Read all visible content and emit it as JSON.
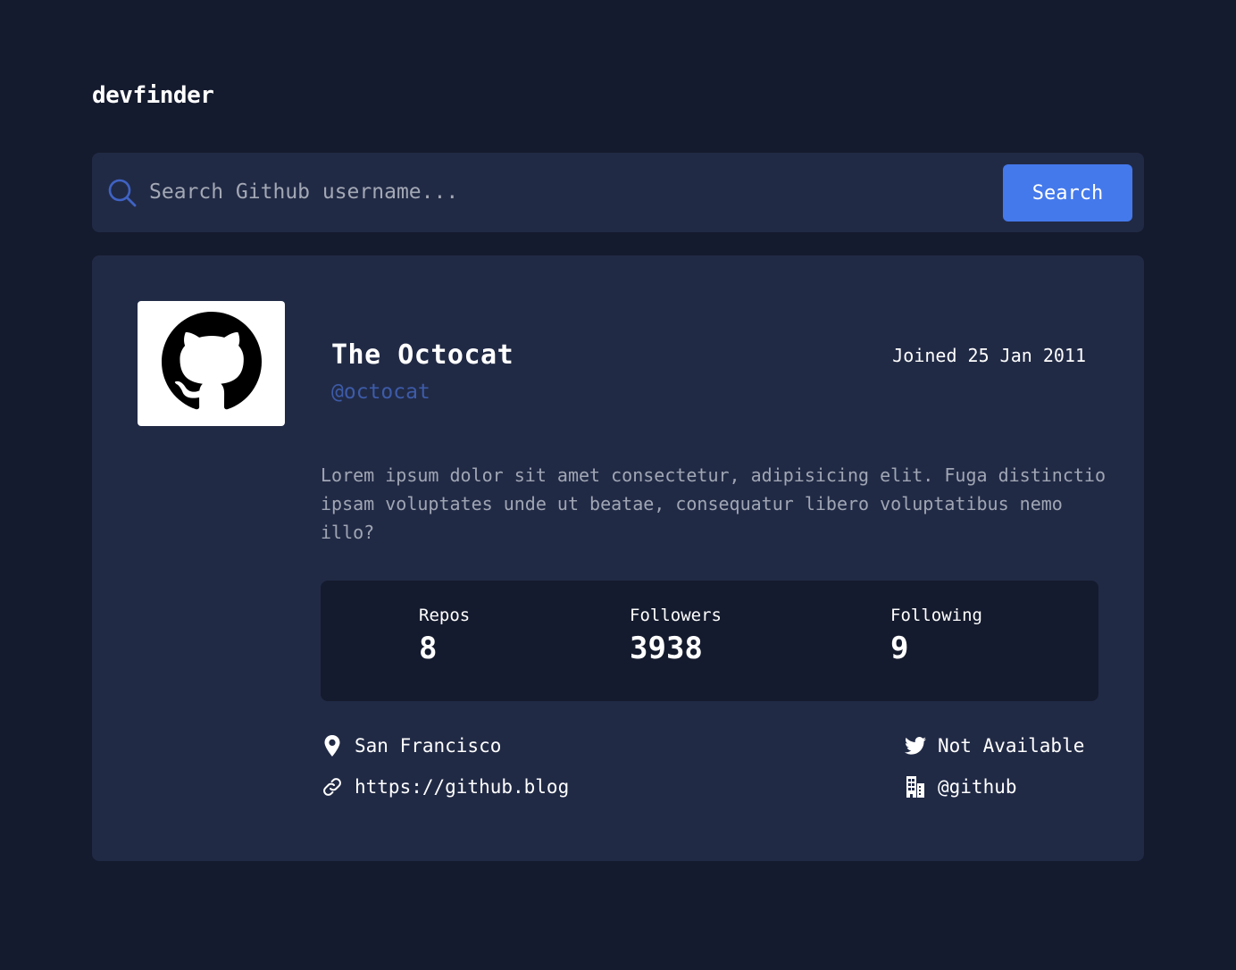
{
  "app": {
    "title": "devfinder"
  },
  "search": {
    "placeholder": "Search Github username...",
    "value": "",
    "button_label": "Search",
    "icon": "search-icon"
  },
  "profile": {
    "name": "The Octocat",
    "login": "@octocat",
    "joined": "Joined 25 Jan 2011",
    "bio": "Lorem ipsum dolor sit amet consectetur, adipisicing elit. Fuga distinctio ipsam voluptates unde ut beatae, consequatur libero voluptatibus nemo illo?",
    "avatar_icon": "github-octocat-icon"
  },
  "stats": {
    "repos_label": "Repos",
    "repos_value": "8",
    "followers_label": "Followers",
    "followers_value": "3938",
    "following_label": "Following",
    "following_value": "9"
  },
  "links": {
    "location": "San Francisco",
    "blog": "https://github.blog",
    "twitter": "Not Available",
    "company": "@github"
  },
  "colors": {
    "background": "#151b2e",
    "card": "#212a45",
    "accent": "#4479ec",
    "login": "#3d5ba8",
    "bio": "#a0a6b4"
  }
}
